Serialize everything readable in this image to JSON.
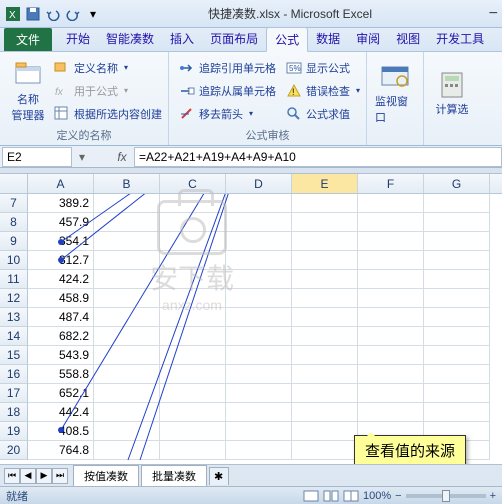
{
  "title": "快捷凑数.xlsx - Microsoft Excel",
  "tabs": {
    "file": "文件",
    "list": [
      "开始",
      "智能凑数",
      "插入",
      "页面布局",
      "公式",
      "数据",
      "审阅",
      "视图",
      "开发工具"
    ],
    "active": "公式"
  },
  "ribbon": {
    "group1": {
      "name_mgr": "名称",
      "name_mgr2": "管理器",
      "define_name": "定义名称",
      "use_in_formula": "用于公式",
      "create_selection": "根据所选内容创建",
      "label": "定义的名称"
    },
    "group2": {
      "trace_precedents": "追踪引用单元格",
      "trace_dependents": "追踪从属单元格",
      "remove_arrows": "移去箭头",
      "show_formulas": "显示公式",
      "error_check": "错误检查",
      "eval_formula": "公式求值",
      "label": "公式审核"
    },
    "group3": {
      "watch": "监视窗口"
    },
    "group4": {
      "calc": "计算选"
    }
  },
  "name_box": "E2",
  "formula": "=A22+A21+A19+A4+A9+A10",
  "columns": [
    "A",
    "B",
    "C",
    "D",
    "E",
    "F",
    "G"
  ],
  "selected_col": "E",
  "rows": [
    {
      "n": 7,
      "a": "389.2"
    },
    {
      "n": 8,
      "a": "457.9"
    },
    {
      "n": 9,
      "a": "354.1"
    },
    {
      "n": 10,
      "a": "312.7"
    },
    {
      "n": 11,
      "a": "424.2"
    },
    {
      "n": 12,
      "a": "458.9"
    },
    {
      "n": 13,
      "a": "487.4"
    },
    {
      "n": 14,
      "a": "682.2"
    },
    {
      "n": 15,
      "a": "543.9"
    },
    {
      "n": 16,
      "a": "558.8"
    },
    {
      "n": 17,
      "a": "652.1"
    },
    {
      "n": 18,
      "a": "442.4"
    },
    {
      "n": 19,
      "a": "408.5"
    },
    {
      "n": 20,
      "a": "764.8"
    }
  ],
  "sheets": [
    "按值凑数",
    "批量凑数"
  ],
  "status": "就绪",
  "zoom": "100%",
  "callout": "查看值的来源",
  "watermark": {
    "text": "安下载",
    "sub": "anxz.com"
  }
}
